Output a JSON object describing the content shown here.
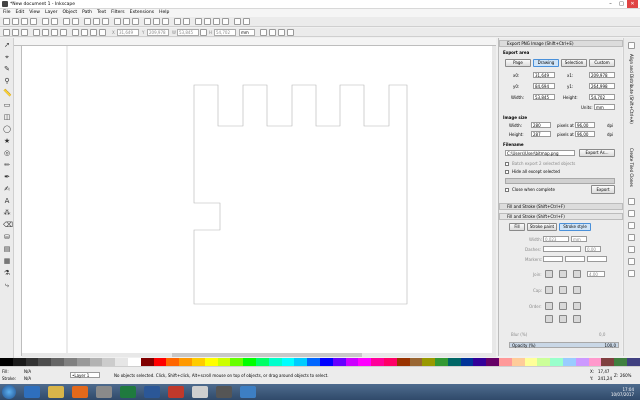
{
  "window": {
    "title": "*New document 1 - Inkscape",
    "controls": [
      "–",
      "□",
      "✕"
    ]
  },
  "menu": [
    "File",
    "Edit",
    "View",
    "Layer",
    "Object",
    "Path",
    "Text",
    "Filters",
    "Extensions",
    "Help"
  ],
  "tool_controls": {
    "x_label": "X",
    "x_value": "31,649",
    "y_label": "Y",
    "y_value": "209,978",
    "w_label": "W",
    "w_value": "53,845",
    "h_label": "H",
    "h_value": "54,702",
    "unit": "mm"
  },
  "export_dialog": {
    "title": "Export PNG Image (Shift+Ctrl+E)",
    "export_area_label": "Export area",
    "area_buttons": [
      "Page",
      "Drawing",
      "Selection",
      "Custom"
    ],
    "active_area": "Drawing",
    "x0_label": "x0:",
    "x0_value": "31,649",
    "x1_label": "x1:",
    "x1_value": "209,978",
    "y0_label": "y0:",
    "y0_value": "84,694",
    "y1_label": "y1:",
    "y1_value": "264,998",
    "width_label": "Width:",
    "width_value": "53,845",
    "height_label": "Height:",
    "height_value": "54,702",
    "units_label": "Units:",
    "units_value": "mm",
    "image_size_label": "Image size",
    "px_width_label": "Width:",
    "px_width_value": "280",
    "px_height_label": "Height:",
    "px_height_value": "287",
    "pixels_at_label": "pixels at",
    "dpi_value": "96,00",
    "dpi_label": "dpi",
    "filename_label": "Filename",
    "filename_value": "C:\\Users\\User\\bitmap.png",
    "export_as_label": "Export As...",
    "batch_label": "Batch export 2 selected objects",
    "hide_label": "Hide all except selected",
    "close_when_complete_label": "Close when complete",
    "export_label": "Export"
  },
  "fill_stroke": {
    "header_title": "Fill and Stroke (Shift+Ctrl+F)",
    "inner_title": "Fill and Stroke (Shift+Ctrl+F)",
    "tabs": [
      "Fill",
      "Stroke paint",
      "Stroke style"
    ],
    "active_tab": "Stroke style",
    "width_label": "Width:",
    "width_value": "0,023",
    "width_unit": "mm",
    "dashes_label": "Dashes:",
    "dashes_value": "0,00",
    "markers_label": "Markers:",
    "join_label": "Join:",
    "join_value": "4,00",
    "cap_label": "Cap:",
    "order_label": "Order:",
    "blur_label": "Blur (%)",
    "blur_value": "0,0",
    "opacity_label": "Opacity (%)",
    "opacity_value": "100,0"
  },
  "right_sidebar": [
    "Align and Distribute (Shift+Ctrl+A)",
    "Create Tiled Clones"
  ],
  "status": {
    "fill_label": "Fill:",
    "fill_value": "N/A",
    "stroke_label": "Stroke:",
    "stroke_value": "N/A",
    "layer_value": "•Layer 1",
    "message": "No objects selected. Click, Shift+click, Alt+scroll mouse on top of objects, or drag around objects to select.",
    "x_label": "X:",
    "x_value": "17,47",
    "y_label": "Y:",
    "y_value": "241,24",
    "zoom_label": "Z:",
    "zoom_value": "260%"
  },
  "taskbar": {
    "time": "17:04",
    "date": "10/07/2017"
  },
  "colors": {
    "accent": "#4a90d9",
    "canvas_path": "#b4b4b4",
    "taskbar": "#3b5778"
  },
  "palette": [
    "#000000",
    "#1a1a1a",
    "#333333",
    "#4d4d4d",
    "#666666",
    "#808080",
    "#999999",
    "#b3b3b3",
    "#cccccc",
    "#e6e6e6",
    "#ffffff",
    "#800000",
    "#ff0000",
    "#ff6600",
    "#ff9900",
    "#ffcc00",
    "#ffff00",
    "#ccff00",
    "#66ff00",
    "#00ff00",
    "#00ff66",
    "#00ffcc",
    "#00ffff",
    "#00ccff",
    "#0066ff",
    "#0000ff",
    "#6600ff",
    "#cc00ff",
    "#ff00ff",
    "#ff0099",
    "#ff0066",
    "#993300",
    "#996633",
    "#999900",
    "#339933",
    "#006666",
    "#003399",
    "#330099",
    "#660066",
    "#ff9999",
    "#ffcc99",
    "#ffff99",
    "#ccff99",
    "#99ffcc",
    "#99ccff",
    "#cc99ff",
    "#ff99cc",
    "#804040",
    "#408040",
    "#404080"
  ]
}
